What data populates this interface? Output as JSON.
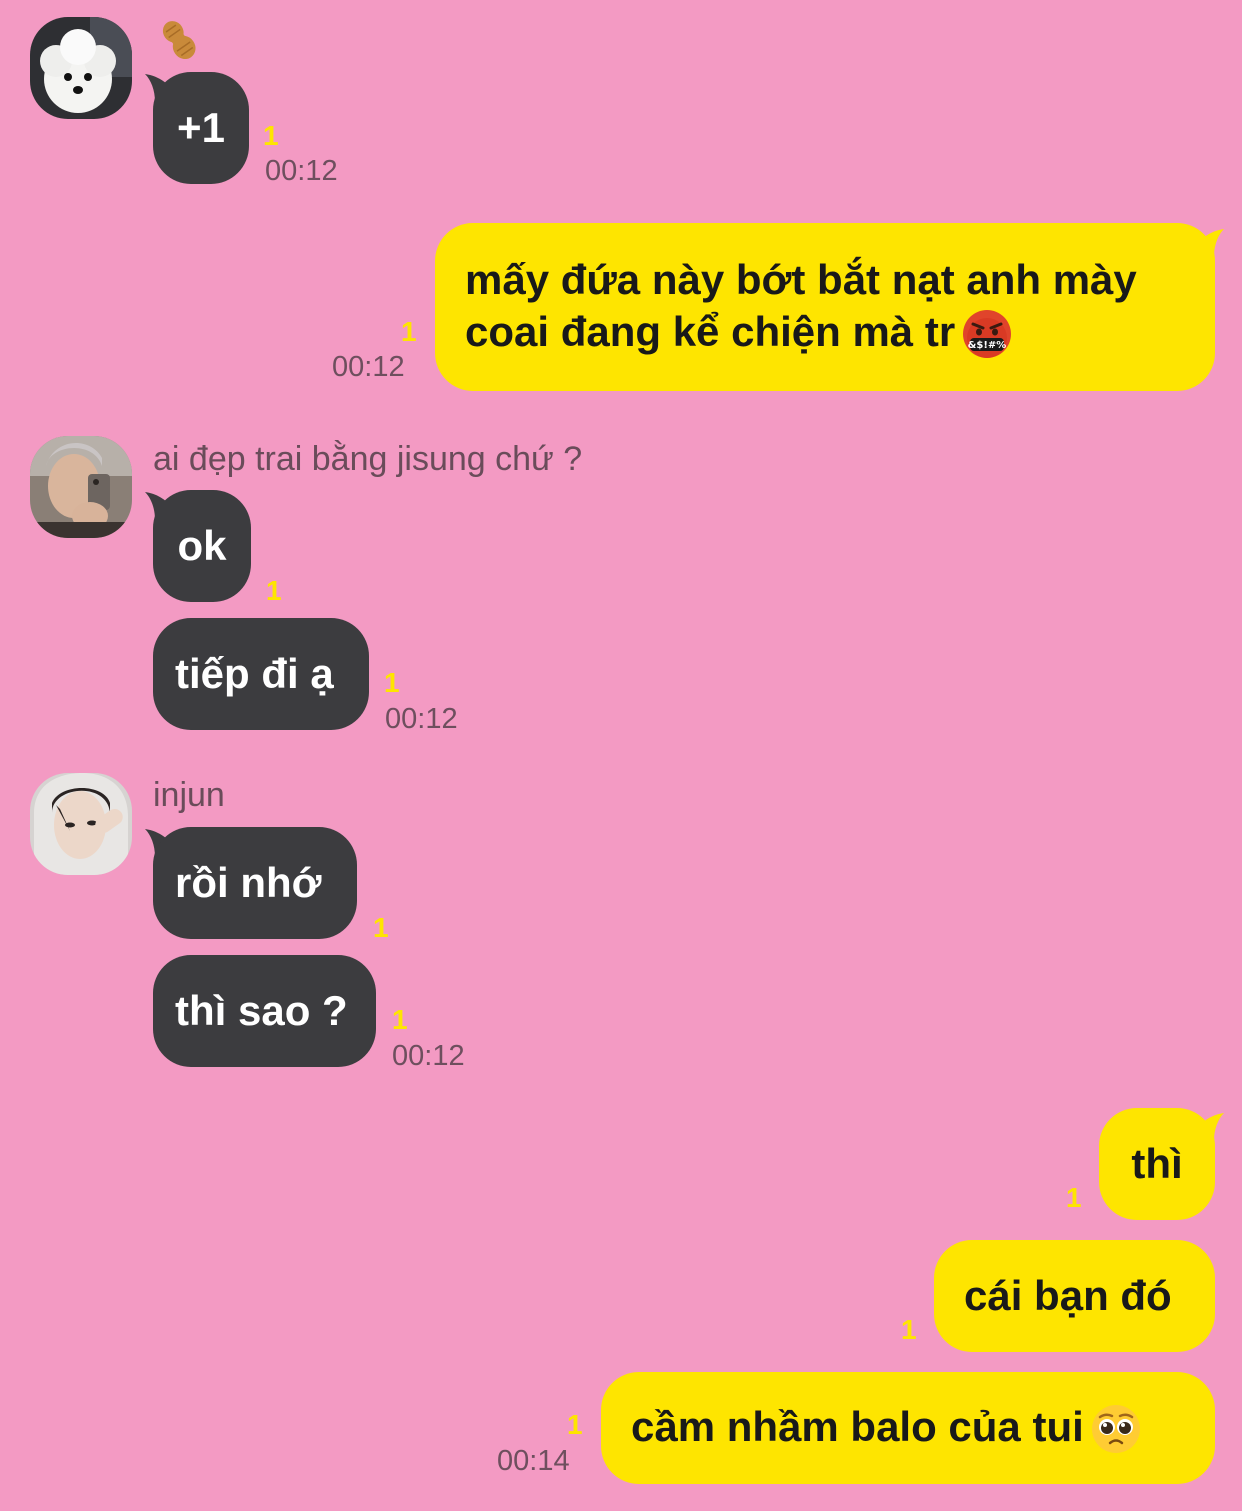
{
  "colors": {
    "background": "#f39ac3",
    "incoming_bubble": "#3c3c3f",
    "outgoing_bubble": "#fee500",
    "unread_count": "#fee500"
  },
  "group1": {
    "sender_icon": "peanut-icon",
    "avatar_icon": "puppy-avatar",
    "msg1": "+1",
    "unread1": "1",
    "time": "00:12"
  },
  "out1": {
    "text": "mấy đứa này bớt bắt nạt anh mày coai  đang kể chiện mà tr",
    "emoji_icon": "cursing-face-emoji",
    "unread": "1",
    "time": "00:12"
  },
  "group2": {
    "sender_name": "ai đẹp trai bằng jisung chứ ?",
    "avatar_icon": "mirror-selfie-avatar",
    "msg1": "ok",
    "unread1": "1",
    "msg2": "tiếp đi ạ",
    "unread2": "1",
    "time": "00:12"
  },
  "group3": {
    "sender_name": "injun",
    "avatar_icon": "hoodie-selfie-avatar",
    "msg1": "rồi nhớ",
    "unread1": "1",
    "msg2": "thì sao ?",
    "unread2": "1",
    "time": "00:12"
  },
  "out2": {
    "msg1": "thì",
    "unread1": "1",
    "msg2": "cái bạn đó",
    "unread2": "1",
    "msg3": "cầm nhầm balo của tui",
    "emoji_icon": "pleading-face-emoji",
    "unread3": "1",
    "time": "00:14"
  }
}
